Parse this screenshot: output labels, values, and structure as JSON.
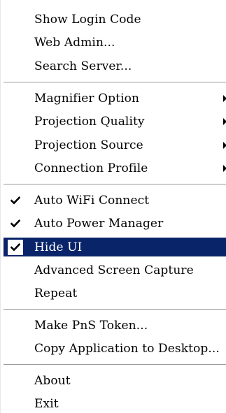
{
  "menu": {
    "items": [
      {
        "id": "show-login-code",
        "label": "Show Login Code",
        "checked": false,
        "submenu": false
      },
      {
        "id": "web-admin",
        "label": "Web Admin...",
        "checked": false,
        "submenu": false
      },
      {
        "id": "search-server",
        "label": "Search Server...",
        "checked": false,
        "submenu": false
      },
      {
        "id": "magnifier-option",
        "label": "Magnifier Option",
        "checked": false,
        "submenu": true
      },
      {
        "id": "projection-quality",
        "label": "Projection Quality",
        "checked": false,
        "submenu": true
      },
      {
        "id": "projection-source",
        "label": "Projection Source",
        "checked": false,
        "submenu": true
      },
      {
        "id": "connection-profile",
        "label": "Connection Profile",
        "checked": false,
        "submenu": true
      },
      {
        "id": "auto-wifi-connect",
        "label": "Auto WiFi Connect",
        "checked": true,
        "submenu": false
      },
      {
        "id": "auto-power-manager",
        "label": "Auto Power Manager",
        "checked": true,
        "submenu": false
      },
      {
        "id": "hide-ui",
        "label": "Hide UI",
        "checked": true,
        "submenu": false,
        "highlighted": true
      },
      {
        "id": "advanced-screen-capture",
        "label": "Advanced Screen Capture",
        "checked": false,
        "submenu": false
      },
      {
        "id": "repeat",
        "label": "Repeat",
        "checked": false,
        "submenu": false
      },
      {
        "id": "make-pns-token",
        "label": "Make PnS Token...",
        "checked": false,
        "submenu": false
      },
      {
        "id": "copy-application-to-desktop",
        "label": "Copy Application to Desktop...",
        "checked": false,
        "submenu": false
      },
      {
        "id": "about",
        "label": "About",
        "checked": false,
        "submenu": false
      },
      {
        "id": "exit",
        "label": "Exit",
        "checked": false,
        "submenu": false
      }
    ]
  },
  "colors": {
    "highlight_background": "#0a246a",
    "highlight_text": "#ffffff",
    "text": "#000000"
  },
  "icons": {
    "check": "checkmark-icon",
    "submenu": "submenu-arrow-icon"
  }
}
